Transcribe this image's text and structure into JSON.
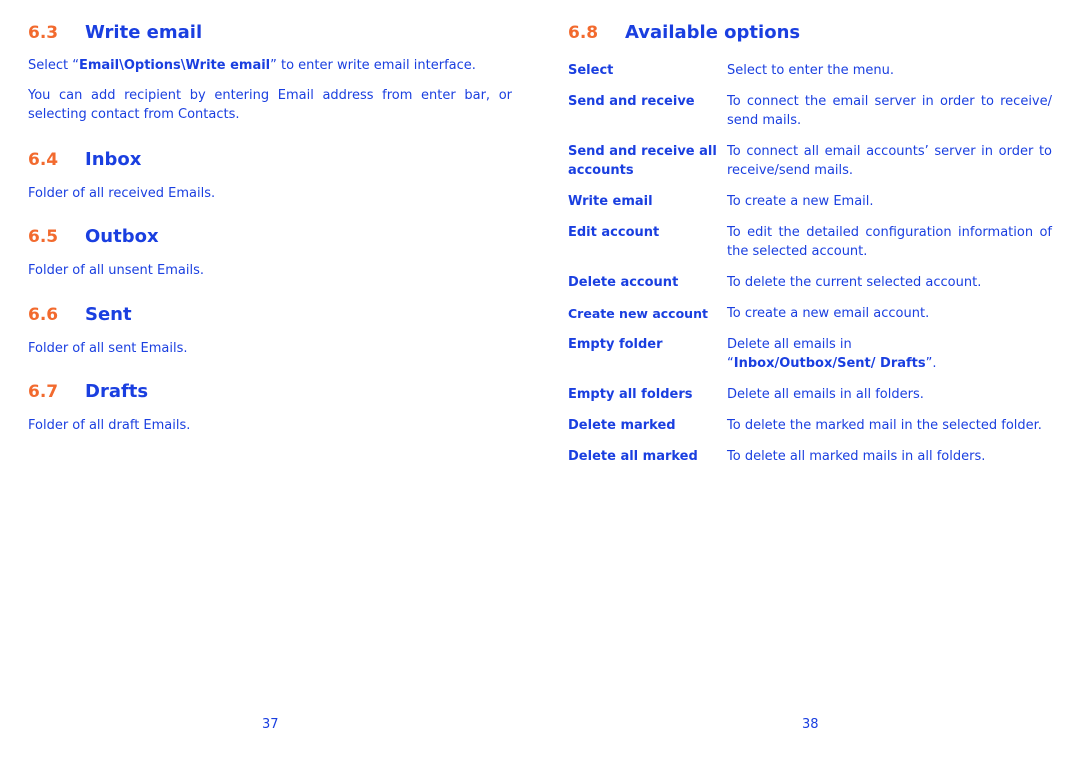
{
  "left_page": {
    "sections": [
      {
        "number": "6.3",
        "title": "Write email",
        "para1_prefix": "Select “",
        "para1_bold": "Email\\Options\\Write email",
        "para1_suffix": "” to enter write email interface.",
        "para2": "You can add recipient by entering Email address from enter bar, or selecting contact from Contacts."
      },
      {
        "number": "6.4",
        "title": "Inbox",
        "text": "Folder of all received Emails."
      },
      {
        "number": "6.5",
        "title": "Outbox",
        "text": "Folder of all unsent Emails."
      },
      {
        "number": "6.6",
        "title": "Sent",
        "text": "Folder of all sent Emails."
      },
      {
        "number": "6.7",
        "title": "Drafts",
        "text": "Folder of all draft Emails."
      }
    ],
    "page_number": "37"
  },
  "right_page": {
    "section": {
      "number": "6.8",
      "title": "Available options"
    },
    "options": [
      {
        "term": "Select",
        "desc": "Select to enter the menu."
      },
      {
        "term": "Send and receive",
        "desc": "To connect the email server in order to receive/ send mails."
      },
      {
        "term": "Send and receive all accounts",
        "desc": "To connect all email accounts’ server in order to receive/send mails."
      },
      {
        "term": "Write email",
        "desc": "To create a new Email."
      },
      {
        "term": "Edit account",
        "desc": "To edit the detailed configuration information of the selected account."
      },
      {
        "term": "Delete account",
        "desc": "To delete the current selected account."
      },
      {
        "term": "Create new account",
        "desc": "To create a new email account."
      },
      {
        "term": "Empty folder",
        "desc_prefix": "Delete all emails in “",
        "desc_bold": "Inbox/Outbox/Sent/ Drafts",
        "desc_suffix": "”."
      },
      {
        "term": "Empty all folders",
        "desc": "Delete all emails in all folders."
      },
      {
        "term": "Delete marked",
        "desc": "To delete the marked mail in the selected folder."
      },
      {
        "term": "Delete all marked",
        "desc": "To delete all marked mails in all folders."
      }
    ],
    "page_number": "38"
  },
  "colors": {
    "text": "#1a3fe0",
    "section_number": "#f26a2e"
  }
}
